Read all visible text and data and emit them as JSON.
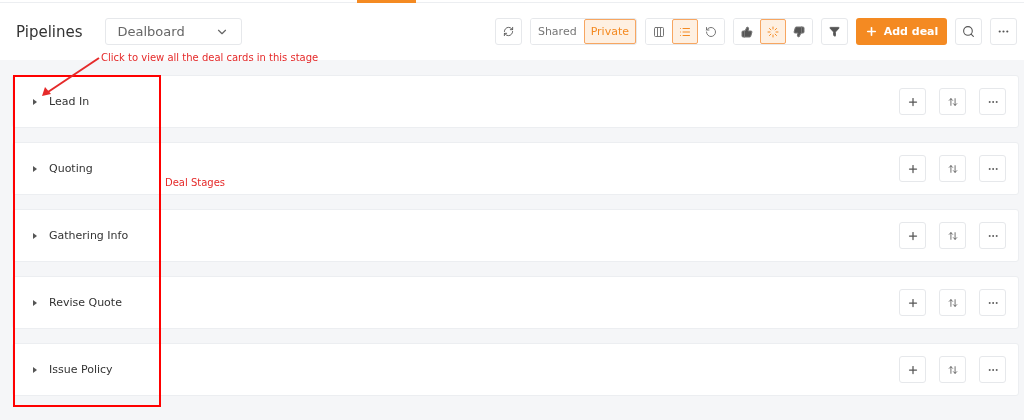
{
  "header": {
    "title": "Pipelines",
    "pipeline_select": {
      "value": "Dealboard"
    }
  },
  "visibility": [
    {
      "label": "Shared",
      "selected": false
    },
    {
      "label": "Private",
      "selected": true
    }
  ],
  "view_modes": [
    {
      "kind": "board",
      "selected": false
    },
    {
      "kind": "list",
      "selected": true
    },
    {
      "kind": "history",
      "selected": false
    }
  ],
  "status_filters": [
    {
      "kind": "won",
      "selected": false
    },
    {
      "kind": "open",
      "selected": true
    },
    {
      "kind": "lost",
      "selected": false
    }
  ],
  "add_button": {
    "label": "Add deal"
  },
  "stages": [
    {
      "name": "Lead In",
      "expanded": false
    },
    {
      "name": "Quoting",
      "expanded": false
    },
    {
      "name": "Gathering Info",
      "expanded": false
    },
    {
      "name": "Revise Quote",
      "expanded": false
    },
    {
      "name": "Issue Policy",
      "expanded": false
    }
  ],
  "annotations": {
    "arrow_note": "Click to view all the deal cards in this stage",
    "box_note": "Deal Stages"
  }
}
